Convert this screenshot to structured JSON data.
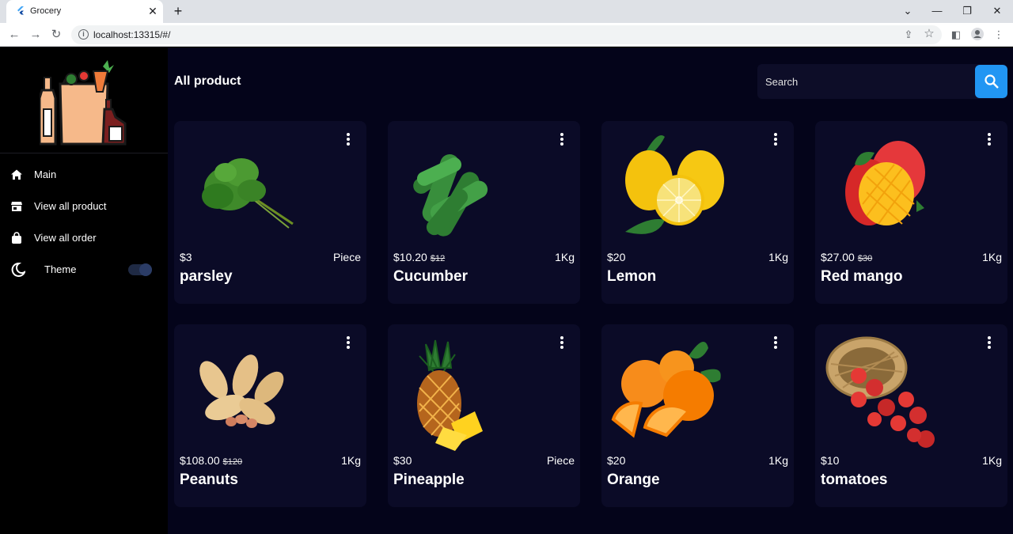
{
  "browser": {
    "tab_title": "Grocery",
    "url": "localhost:13315/#/"
  },
  "sidebar": {
    "items": [
      {
        "label": "Main",
        "icon": "home-icon"
      },
      {
        "label": "View all product",
        "icon": "store-icon"
      },
      {
        "label": "View all order",
        "icon": "shopping-bag-icon"
      }
    ],
    "theme_label": "Theme",
    "theme_icon": "moon-icon",
    "theme_dark": true
  },
  "header": {
    "title": "All product",
    "search_placeholder": "Search"
  },
  "colors": {
    "background": "#04041a",
    "card": "#0b0b27",
    "accent": "#2196f3"
  },
  "products": [
    {
      "name": "parsley",
      "price": "$3",
      "old_price": "",
      "unit": "Piece",
      "image": "parsley"
    },
    {
      "name": "Cucumber",
      "price": "$10.20",
      "old_price": "$12",
      "unit": "1Kg",
      "image": "cucumber"
    },
    {
      "name": "Lemon",
      "price": "$20",
      "old_price": "",
      "unit": "1Kg",
      "image": "lemon"
    },
    {
      "name": "Red mango",
      "price": "$27.00",
      "old_price": "$30",
      "unit": "1Kg",
      "image": "mango"
    },
    {
      "name": "Peanuts",
      "price": "$108.00",
      "old_price": "$120",
      "unit": "1Kg",
      "image": "peanuts"
    },
    {
      "name": "Pineapple",
      "price": "$30",
      "old_price": "",
      "unit": "Piece",
      "image": "pineapple"
    },
    {
      "name": "Orange",
      "price": "$20",
      "old_price": "",
      "unit": "1Kg",
      "image": "orange"
    },
    {
      "name": "tomatoes",
      "price": "$10",
      "old_price": "",
      "unit": "1Kg",
      "image": "tomatoes"
    }
  ]
}
